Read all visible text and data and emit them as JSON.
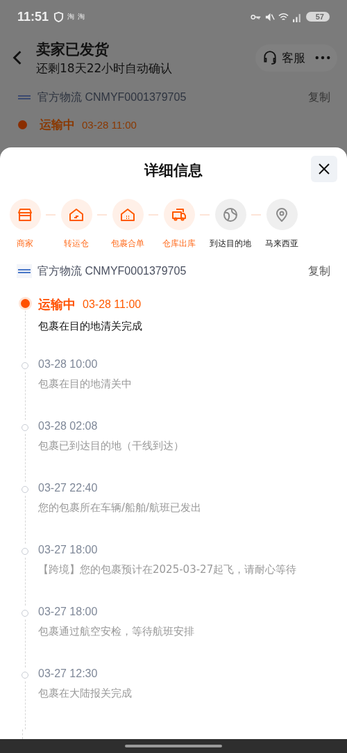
{
  "status_bar": {
    "time": "11:51",
    "app_icons": [
      "淘",
      "淘"
    ],
    "battery": "57"
  },
  "header": {
    "title": "卖家已发货",
    "subtitle": "还剩18天22小时自动确认",
    "service": "客服"
  },
  "background_tracking": {
    "carrier": "官方物流 CNMYF0001379705",
    "copy": "复制",
    "status": "运输中",
    "time": "03-28 11:00"
  },
  "sheet": {
    "title": "详细信息",
    "steps": [
      {
        "label": "商家",
        "done": true,
        "kind": "store"
      },
      {
        "label": "转运仓",
        "done": true,
        "kind": "warehouse"
      },
      {
        "label": "包裹合单",
        "done": true,
        "kind": "house"
      },
      {
        "label": "仓库出库",
        "done": true,
        "kind": "truck"
      },
      {
        "label": "到达目的地",
        "done": false,
        "kind": "globe"
      },
      {
        "label": "马来西亚",
        "done": false,
        "kind": "pin"
      }
    ],
    "tracking": {
      "carrier": "官方物流 CNMYF0001379705",
      "copy": "复制"
    },
    "events": [
      {
        "current": true,
        "status": "运输中",
        "time": "03-28 11:00",
        "desc": "包裹在目的地清关完成"
      },
      {
        "current": false,
        "time": "03-28 10:00",
        "desc": "包裹在目的地清关中"
      },
      {
        "current": false,
        "time": "03-28 02:08",
        "desc": "包裹已到达目的地（干线到达）"
      },
      {
        "current": false,
        "time": "03-27 22:40",
        "desc": "您的包裹所在车辆/船舶/航班已发出"
      },
      {
        "current": false,
        "time": "03-27 18:00",
        "desc": "【跨境】您的包裹预计在2025-03-27起飞，请耐心等待"
      },
      {
        "current": false,
        "time": "03-27 18:00",
        "desc": "包裹通过航空安检，等待航班安排"
      },
      {
        "current": false,
        "time": "03-27 12:30",
        "desc": "包裹在大陆报关完成"
      }
    ]
  }
}
